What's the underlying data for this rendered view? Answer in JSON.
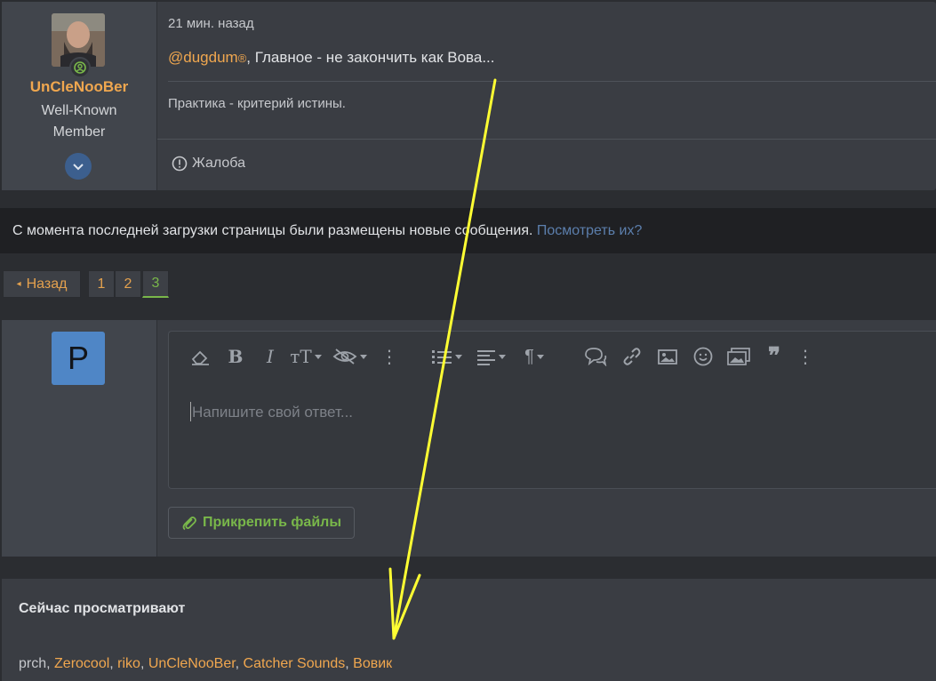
{
  "post": {
    "username": "UnCleNooBer",
    "user_title": "Well-Known Member",
    "date": "21 мин. назад",
    "mention": "@dugdum",
    "mention_mark": "®",
    "message_rest": ", Главное - не закончить как Вова...",
    "signature": "Практика - критерий истины.",
    "report_label": "Жалоба"
  },
  "notice": {
    "text": "С момента последней загрузки страницы были размещены новые сообщения.",
    "link": "Посмотреть их?"
  },
  "pagination": {
    "back_label": "Назад",
    "pages": [
      "1",
      "2",
      "3"
    ],
    "current": "3"
  },
  "reply": {
    "avatar_letter": "P",
    "placeholder": "Напишите свой ответ...",
    "attach_label": "Прикрепить файлы",
    "toolbar": [
      "eraser-icon",
      "bold-icon",
      "italic-icon",
      "text-size-icon",
      "hidden-icon",
      "more-icon",
      "list-icon",
      "align-icon",
      "paragraph-icon",
      "chat-quote-icon",
      "link-icon",
      "image-icon",
      "smile-icon",
      "media-icon",
      "quote-icon",
      "more-icon"
    ]
  },
  "viewers": {
    "title": "Сейчас просматривают",
    "guest": "prch",
    "users": [
      "Zerocool",
      "riko",
      "UnCleNooBer",
      "Catcher Sounds",
      "Вовик"
    ]
  },
  "colors": {
    "accent": "#f0a74f",
    "link": "#5c7fad",
    "green": "#79b74a",
    "annotation": "#ffff33"
  }
}
